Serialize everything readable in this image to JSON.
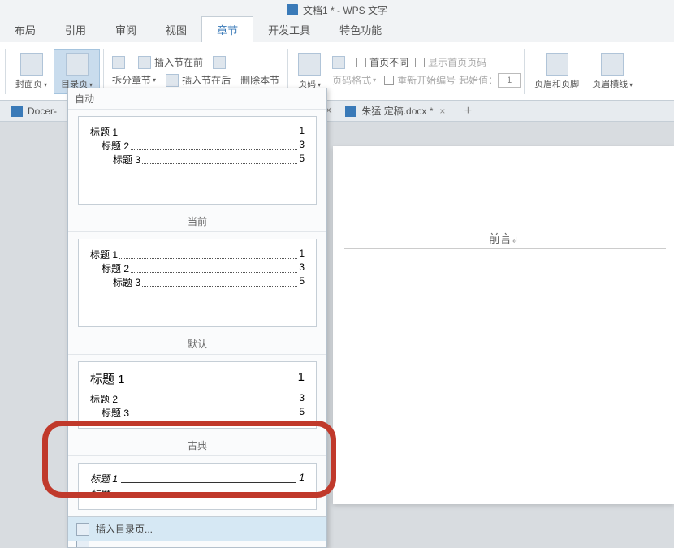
{
  "app": {
    "title": "文档1 * - WPS 文字"
  },
  "menu": {
    "tabs": [
      "布局",
      "引用",
      "审阅",
      "视图",
      "章节",
      "开发工具",
      "特色功能"
    ],
    "active": 4
  },
  "ribbon": {
    "cover": "封面页",
    "toc": "目录页",
    "split": "拆分章节",
    "ins_before": "插入节在前",
    "ins_after": "插入节在后",
    "del_section": "删除本节",
    "page_num": "页码",
    "num_format": "页码格式",
    "first_diff": "首页不同",
    "show_first": "显示首页页码",
    "restart": "重新开始编号",
    "start_at_label": "起始值：",
    "start_at_value": "1",
    "header_footer": "页眉和页脚",
    "header_line": "页眉横线"
  },
  "doc_tabs": {
    "tab1": "Docer-",
    "tab2": "朱猛 定稿.docx *"
  },
  "page": {
    "preface": "前言"
  },
  "dropdown": {
    "section_auto": "自动",
    "section_current": "当前",
    "section_default": "默认",
    "section_classic": "古典",
    "preview1": {
      "h1": "标题 1",
      "h2": "标题 2",
      "h3": "标题 3",
      "p1": "1",
      "p2": "3",
      "p3": "5"
    },
    "insert_toc": "插入目录页..."
  }
}
